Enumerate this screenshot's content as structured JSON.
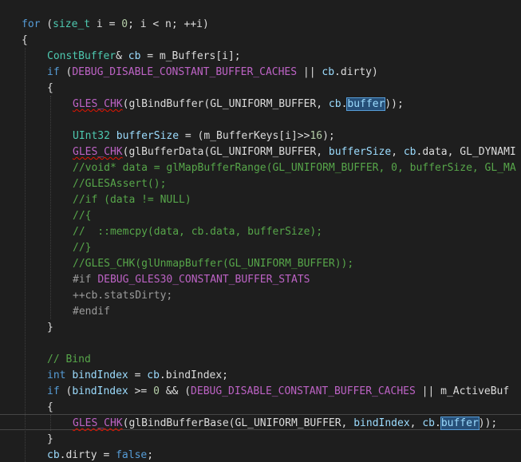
{
  "editor": {
    "colors": {
      "background": "#1e1e1e",
      "keyword": "#569cd6",
      "type": "#4ec9b0",
      "macro": "#bd63c5",
      "variable": "#9cdcfe",
      "comment": "#57a64a",
      "preprocessor": "#9b9b9b",
      "number": "#b5cea8",
      "plain": "#dcdcdc",
      "highlight": "#264f78"
    },
    "lines": [
      [
        {
          "t": "for",
          "c": "kw"
        },
        {
          "t": " (",
          "c": "pl"
        },
        {
          "t": "size_t",
          "c": "ty"
        },
        {
          "t": " i = ",
          "c": "pl"
        },
        {
          "t": "0",
          "c": "num"
        },
        {
          "t": "; i < n; ++i)",
          "c": "pl"
        }
      ],
      [
        {
          "t": "{",
          "c": "pl"
        }
      ],
      [
        {
          "t": "ConstBuffer",
          "c": "ty"
        },
        {
          "t": "& ",
          "c": "pl"
        },
        {
          "t": "cb",
          "c": "var"
        },
        {
          "t": " = m_Buffers[i];",
          "c": "pl"
        }
      ],
      [
        {
          "t": "if",
          "c": "kw"
        },
        {
          "t": " (",
          "c": "pl"
        },
        {
          "t": "DEBUG_DISABLE_CONSTANT_BUFFER_CACHES",
          "c": "mac"
        },
        {
          "t": " || ",
          "c": "pl"
        },
        {
          "t": "cb",
          "c": "var"
        },
        {
          "t": ".dirty)",
          "c": "pl"
        }
      ],
      [
        {
          "t": "{",
          "c": "pl"
        }
      ],
      [
        {
          "t": "GLES_CHK",
          "c": "mac",
          "err": true
        },
        {
          "t": "(glBindBuffer(GL_UNIFORM_BUFFER, ",
          "c": "pl"
        },
        {
          "t": "cb",
          "c": "var"
        },
        {
          "t": ".",
          "c": "pl"
        },
        {
          "t": "buffer",
          "c": "var",
          "hl": true
        },
        {
          "t": "));",
          "c": "pl"
        }
      ],
      [],
      [
        {
          "t": "UInt32",
          "c": "ty"
        },
        {
          "t": " ",
          "c": "pl"
        },
        {
          "t": "bufferSize",
          "c": "var"
        },
        {
          "t": " = (m_BufferKeys[i]>>",
          "c": "pl"
        },
        {
          "t": "16",
          "c": "num"
        },
        {
          "t": ");",
          "c": "pl"
        }
      ],
      [
        {
          "t": "GLES_CHK",
          "c": "mac",
          "err": true
        },
        {
          "t": "(glBufferData(GL_UNIFORM_BUFFER, ",
          "c": "pl"
        },
        {
          "t": "bufferSize",
          "c": "var"
        },
        {
          "t": ", ",
          "c": "pl"
        },
        {
          "t": "cb",
          "c": "var"
        },
        {
          "t": ".data, GL_DYNAMI",
          "c": "pl"
        }
      ],
      [
        {
          "t": "//void* data = glMapBufferRange(GL_UNIFORM_BUFFER, 0, bufferSize, GL_MA",
          "c": "cm"
        }
      ],
      [
        {
          "t": "//GLESAssert();",
          "c": "cm"
        }
      ],
      [
        {
          "t": "//if (data != NULL)",
          "c": "cm"
        }
      ],
      [
        {
          "t": "//{",
          "c": "cm"
        }
      ],
      [
        {
          "t": "//  ::memcpy(data, cb.data, bufferSize);",
          "c": "cm"
        }
      ],
      [
        {
          "t": "//}",
          "c": "cm"
        }
      ],
      [
        {
          "t": "//GLES_CHK(glUnmapBuffer(GL_UNIFORM_BUFFER));",
          "c": "cm"
        }
      ],
      [
        {
          "t": "#if",
          "c": "pp"
        },
        {
          "t": " ",
          "c": "pl"
        },
        {
          "t": "DEBUG_GLES30_CONSTANT_BUFFER_STATS",
          "c": "mac"
        }
      ],
      [
        {
          "t": "++cb.statsDirty;",
          "c": "pp"
        }
      ],
      [
        {
          "t": "#endif",
          "c": "pp"
        }
      ],
      [
        {
          "t": "}",
          "c": "pl"
        }
      ],
      [],
      [
        {
          "t": "// Bind",
          "c": "cm"
        }
      ],
      [
        {
          "t": "int",
          "c": "kw"
        },
        {
          "t": " ",
          "c": "pl"
        },
        {
          "t": "bindIndex",
          "c": "var"
        },
        {
          "t": " = ",
          "c": "pl"
        },
        {
          "t": "cb",
          "c": "var"
        },
        {
          "t": ".bindIndex;",
          "c": "pl"
        }
      ],
      [
        {
          "t": "if",
          "c": "kw"
        },
        {
          "t": " (",
          "c": "pl"
        },
        {
          "t": "bindIndex",
          "c": "var"
        },
        {
          "t": " >= ",
          "c": "pl"
        },
        {
          "t": "0",
          "c": "num"
        },
        {
          "t": " && (",
          "c": "pl"
        },
        {
          "t": "DEBUG_DISABLE_CONSTANT_BUFFER_CACHES",
          "c": "mac"
        },
        {
          "t": " || m_ActiveBuf",
          "c": "pl"
        }
      ],
      [
        {
          "t": "{",
          "c": "pl"
        }
      ],
      [
        {
          "t": "GLES_CHK",
          "c": "mac",
          "err": true
        },
        {
          "t": "(glBindBufferBase(GL_UNIFORM_BUFFER, ",
          "c": "pl"
        },
        {
          "t": "bindIndex",
          "c": "var"
        },
        {
          "t": ", ",
          "c": "pl"
        },
        {
          "t": "cb",
          "c": "var"
        },
        {
          "t": ".",
          "c": "pl"
        },
        {
          "t": "buffer",
          "c": "var",
          "hl": true
        },
        {
          "t": "));",
          "c": "pl"
        }
      ],
      [
        {
          "t": "}",
          "c": "pl"
        }
      ],
      [
        {
          "t": "cb",
          "c": "var"
        },
        {
          "t": ".dirty = ",
          "c": "pl"
        },
        {
          "t": "false",
          "c": "kw"
        },
        {
          "t": ";",
          "c": "pl"
        }
      ]
    ]
  }
}
